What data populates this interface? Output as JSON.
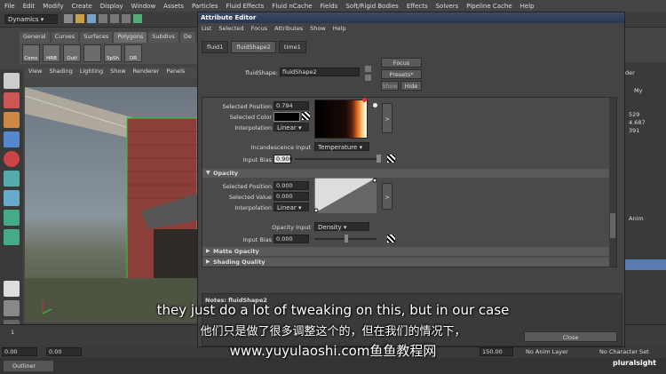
{
  "maya": {
    "menubar": [
      "File",
      "Edit",
      "Modify",
      "Create",
      "Display",
      "Window",
      "Assets",
      "Particles",
      "Fluid Effects",
      "Fluid nCache",
      "Fields",
      "Soft/Rigid Bodies",
      "Effects",
      "Solvers",
      "Pipeline Cache",
      "Help"
    ],
    "mode_menu": "Dynamics",
    "shelf_tabs": [
      "General",
      "Curves",
      "Surfaces",
      "Polygons",
      "Subdivs",
      "De"
    ],
    "active_shelf_tab": "Polygons",
    "shelf_buttons": [
      "Comc",
      "HRB",
      "Outl",
      "",
      "SpSh",
      "DR"
    ],
    "viewport_menu": [
      "View",
      "Shading",
      "Lighting",
      "Show",
      "Renderer",
      "Panels"
    ],
    "timeline_ticks": [
      "1",
      "",
      "",
      "",
      "",
      "",
      "",
      "",
      "",
      "",
      "",
      ""
    ],
    "range_start": "0.00",
    "range_start2": "0.00",
    "range_end": "150.00",
    "anim_layer": "No Anim Layer",
    "char_set": "No Character Set",
    "outliner_tab": "Outliner",
    "right_panel": {
      "values": [
        "529",
        "4.687",
        "391"
      ],
      "label_der": "der",
      "label_my": "My",
      "label_anim": "Anim"
    }
  },
  "ae": {
    "title": "Attribute Editor",
    "menu": [
      "List",
      "Selected",
      "Focus",
      "Attributes",
      "Show",
      "Help"
    ],
    "tabs": [
      "fluid1",
      "fluidShape2",
      "time1"
    ],
    "active_tab": "fluidShape2",
    "node_label": "fluidShape:",
    "node_value": "fluidShape2",
    "focus_btn": "Focus",
    "presets_btn": "Presets*",
    "show_btn": "Show",
    "hide_btn": "Hide",
    "incandescence": {
      "selected_position_label": "Selected Position",
      "selected_position": "0.794",
      "selected_color_label": "Selected Color",
      "interpolation_label": "Interpolation",
      "interpolation": "Linear",
      "input_label": "Incandescence Input",
      "input": "Temperature",
      "input_bias_label": "Input Bias",
      "input_bias": "0.900"
    },
    "opacity": {
      "title": "Opacity",
      "selected_position_label": "Selected Position",
      "selected_position": "0.000",
      "selected_value_label": "Selected Value",
      "selected_value": "0.000",
      "interpolation_label": "Interpolation",
      "interpolation": "Linear",
      "input_label": "Opacity Input",
      "input": "Density",
      "input_bias_label": "Input Bias",
      "input_bias": "0.000"
    },
    "sections": [
      "Matte Opacity",
      "Shading Quality"
    ],
    "notes": "Notes:  fluidShape2",
    "close_btn": "Close",
    "arrow_btn": ">"
  },
  "subtitle": {
    "en": "they just do a lot of tweaking on this, but in our case",
    "zh": "他们只是做了很多调整这个的，但在我们的情况下，",
    "watermark": "www.yuyulaoshi.com鱼鱼教程网",
    "logo": "pluralsight"
  },
  "colors": {
    "title_bar": "#2a3650",
    "accent_red": "#d33"
  }
}
